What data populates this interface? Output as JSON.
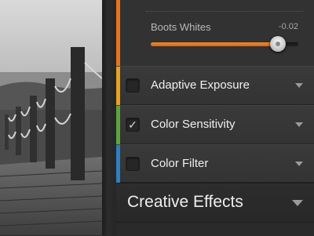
{
  "photo": {
    "icon": "boardwalk-photo"
  },
  "slider": {
    "label": "Boots Whites",
    "value": "-0.02",
    "fill_fraction": 0.86,
    "accent_color": "#e8731f"
  },
  "rows": [
    {
      "label": "Adaptive Exposure",
      "checked": false,
      "check_glyph": "",
      "accent_color": "#e8a11f"
    },
    {
      "label": "Color Sensitivity",
      "checked": true,
      "check_glyph": "✓",
      "accent_color": "#5aa63a"
    },
    {
      "label": "Color Filter",
      "checked": false,
      "check_glyph": "",
      "accent_color": "#2e7fbf"
    }
  ],
  "section": {
    "label": "Creative Effects"
  }
}
